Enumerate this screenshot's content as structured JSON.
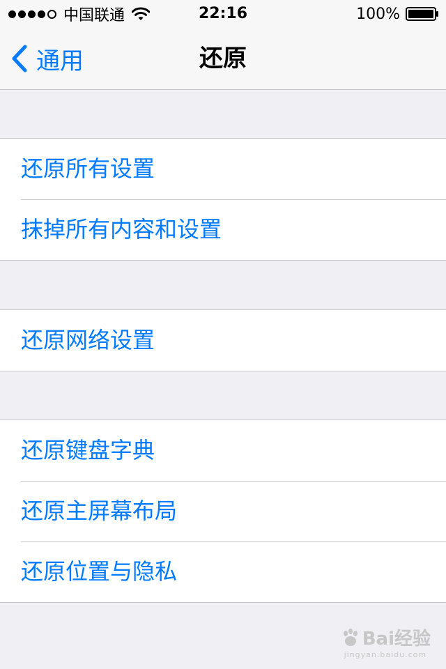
{
  "status_bar": {
    "carrier": "中国联通",
    "time": "22:16",
    "battery": "100%",
    "signal_bars_filled": 4,
    "signal_bars_total": 5
  },
  "nav": {
    "back_label": "通用",
    "title": "还原"
  },
  "groups": [
    {
      "items": [
        "还原所有设置",
        "抹掉所有内容和设置"
      ]
    },
    {
      "items": [
        "还原网络设置"
      ]
    },
    {
      "items": [
        "还原键盘字典",
        "还原主屏幕布局",
        "还原位置与隐私"
      ]
    }
  ],
  "watermark": {
    "main": "Bai经验",
    "sub": "jingyan.baidu.com"
  },
  "colors": {
    "accent": "#007aff",
    "background": "#efeff4",
    "separator": "#c8c7cc"
  }
}
